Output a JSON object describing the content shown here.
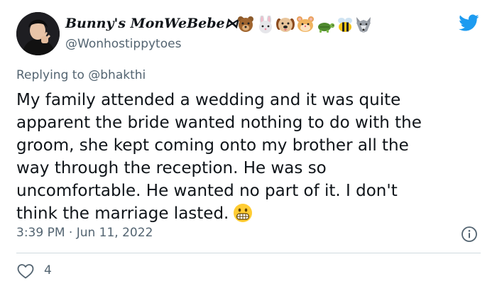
{
  "author": {
    "display_name": "Bunny's MonWeBebe⋈⁷",
    "handle": "@Wonhostippytoes",
    "name_emojis": [
      "bear-face",
      "rabbit-face",
      "dog-face",
      "hamster-face",
      "turtle",
      "honeybee",
      "wolf-face"
    ]
  },
  "reply": {
    "prefix": "Replying to",
    "mention": "@bhakthi"
  },
  "tweet": {
    "lines": [
      "My family attended a wedding and it was quite",
      "apparent the bride wanted nothing to do with the",
      "groom, she kept coming onto my brother all the",
      "way through the reception. He was so",
      "uncomfortable. He wanted no part of it. I don't",
      "think the marriage lasted."
    ],
    "trailing_emoji": "grimacing-face",
    "timestamp": "3:39 PM · Jun 11, 2022"
  },
  "stats": {
    "likes": "4"
  },
  "colors": {
    "text": "#0f1419",
    "secondary": "#536471",
    "twitter_blue": "#1d9bf0",
    "divider": "#cfd9de"
  }
}
